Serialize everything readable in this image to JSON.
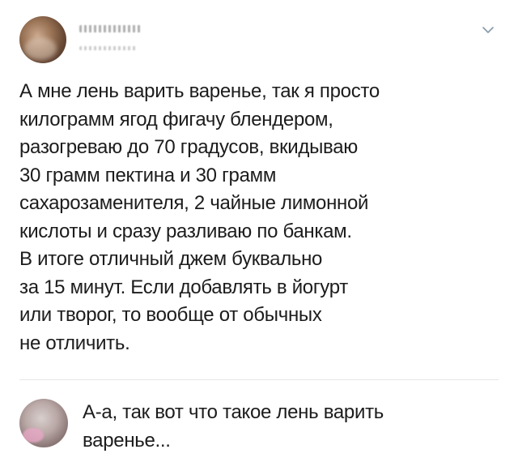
{
  "tweet": {
    "text": "А мне лень варить варенье, так я просто\nкилограмм ягод фигачу блендером,\nразогреваю до 70 градусов, вкидываю\n30 грамм пектина и 30 грамм\nсахарозаменителя, 2 чайные лимонной\nкислоты и сразу разливаю по банкам.\nВ итоге отличный джем буквально\nза 15 минут. Если добавлять в йогурт\nили творог, то вообще от обычных\nне отличить."
  },
  "reply": {
    "text": "А-а, так вот что такое лень варить\nваренье..."
  },
  "icons": {
    "menu": "chevron-down-icon"
  },
  "colors": {
    "text": "#1c1c1c",
    "chevron": "#8899a6",
    "divider": "#e3e6ea"
  }
}
